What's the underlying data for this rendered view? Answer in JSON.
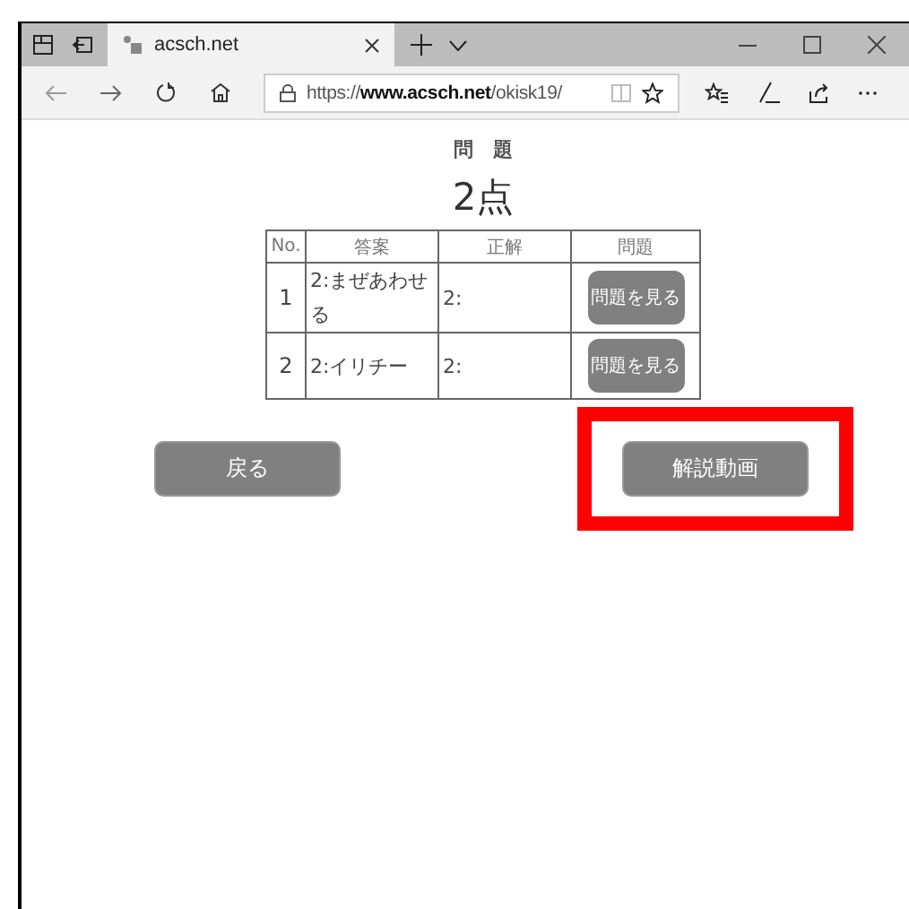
{
  "browser": {
    "tab_title": "acsch.net",
    "url_prefix": "https://",
    "url_host": "www.acsch.net",
    "url_path": "/okisk19/"
  },
  "page": {
    "heading": "問　題",
    "score": "2点",
    "table": {
      "columns": [
        "No.",
        "答案",
        "正解",
        "問題"
      ],
      "rows": [
        {
          "no": "1",
          "answer": "2:まぜあわせる",
          "correct": "2:",
          "button": "問題を見る"
        },
        {
          "no": "2",
          "answer": "2:イリチー",
          "correct": "2:",
          "button": "問題を見る"
        }
      ]
    },
    "buttons": [
      {
        "label": "戻る",
        "highlighted": false
      },
      {
        "label": "解説動画",
        "highlighted": true
      }
    ]
  }
}
